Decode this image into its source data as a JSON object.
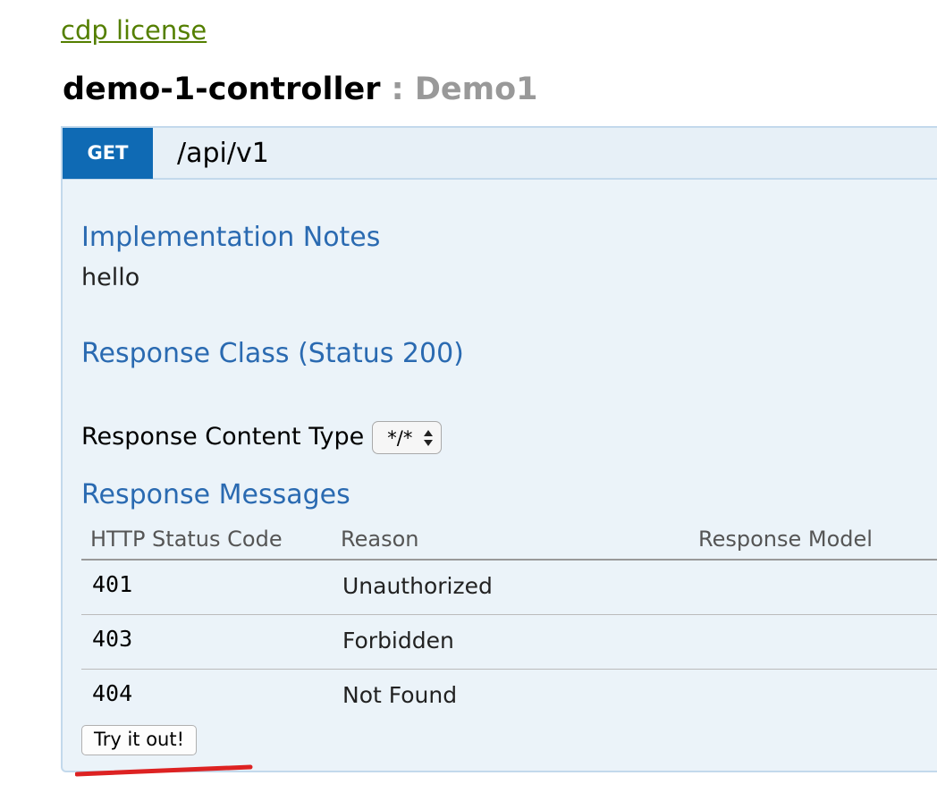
{
  "license_link": "cdp license",
  "controller": {
    "name": "demo-1-controller",
    "separator": " : ",
    "description": "Demo1"
  },
  "operation": {
    "method": "GET",
    "path": "/api/v1",
    "implementation_notes_title": "Implementation Notes",
    "implementation_notes": "hello",
    "response_class_title": "Response Class (Status 200)",
    "response_content_type_label": "Response Content Type",
    "response_content_type_value": "*/*",
    "response_messages_title": "Response Messages",
    "table_headers": {
      "status_code": "HTTP Status Code",
      "reason": "Reason",
      "response_model": "Response Model"
    },
    "responses": [
      {
        "code": "401",
        "reason": "Unauthorized"
      },
      {
        "code": "403",
        "reason": "Forbidden"
      },
      {
        "code": "404",
        "reason": "Not Found"
      }
    ],
    "try_button": "Try it out!"
  },
  "colors": {
    "link_green": "#547f00",
    "method_blue": "#0f6ab4",
    "section_title_blue": "#2a6ab1",
    "panel_background": "#ebf3f9",
    "annotation_red": "#dd2222"
  }
}
